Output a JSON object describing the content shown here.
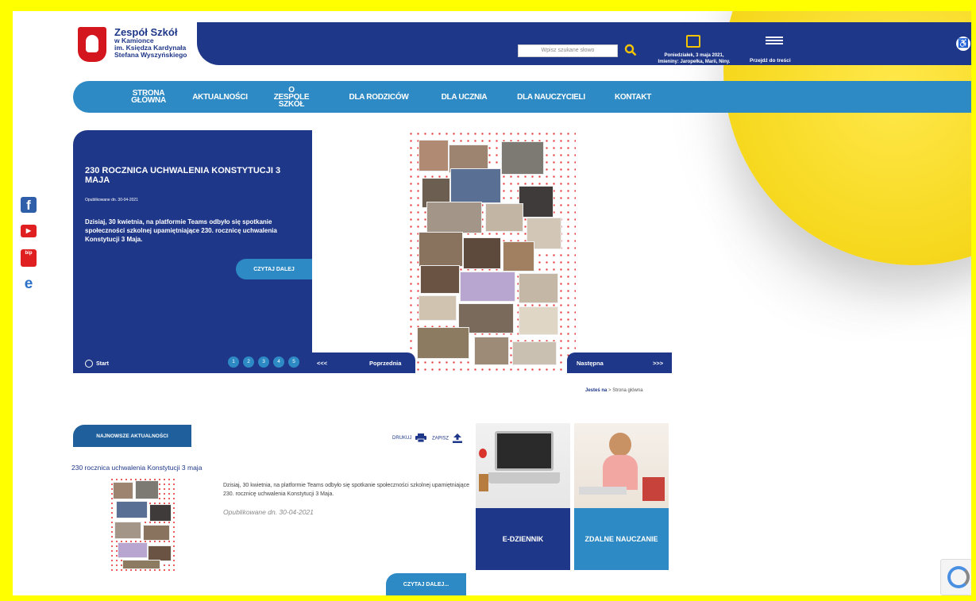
{
  "logo": {
    "line1": "Zespół Szkół",
    "line2": "w Kamionce",
    "line3": "im. Księdza Kardynała",
    "line4": "Stefana Wyszyńskiego"
  },
  "header": {
    "search_placeholder": "Wpisz szukane słowo",
    "date_line1": "Poniedziałek, 3 maja 2021,",
    "date_line2": "Imieniny: Jaropełka, Marii, Niny.",
    "skip_label": "Przejdź do treści"
  },
  "nav": {
    "items": [
      "STRONA GŁÓWNA",
      "AKTUALNOŚCI",
      "O ZESPOLE SZKÓŁ",
      "DLA RODZICÓW",
      "DLA UCZNIA",
      "DLA NAUCZYCIELI",
      "KONTAKT"
    ]
  },
  "hero": {
    "title": "230 ROCZNICA UCHWALENIA KONSTYTUCJI 3 MAJA",
    "date": "Opublikowane dn. 30-04-2021",
    "text": "Dzisiaj, 30 kwietnia, na platformie Teams odbyło się spotkanie społeczności szkolnej upamiętniające 230. rocznicę uchwalenia Konstytucji 3 Maja.",
    "read_more": "CZYTAJ DALEJ",
    "start_label": "Start",
    "pages": [
      "1",
      "2",
      "3",
      "4",
      "5"
    ],
    "prev_arrows": "<<<",
    "prev_label": "Poprzednia",
    "next_label": "Następna",
    "next_arrows": ">>>"
  },
  "breadcrumb": {
    "prefix": "Jesteś na",
    "sep": " > ",
    "current": "Strona główna"
  },
  "news": {
    "tab_label": "NAJNOWSZE AKTUALNOŚCI",
    "print_label": "DRUKUJ",
    "save_label": "ZAPISZ",
    "title": "230 rocznica uchwalenia Konstytucji 3 maja",
    "text": "Dzisiaj, 30 kwietnia, na platformie Teams odbyło się spotkanie społeczności szkolnej upamiętniające 230. rocznicę uchwalenia Konstytucji 3 Maja.",
    "date": "Opublikowane dn. 30-04-2021",
    "read_more": "CZYTAJ DALEJ..."
  },
  "tiles": {
    "ediary": "E-DZIENNIK",
    "remote": "ZDALNE NAUCZANIE"
  },
  "social": {
    "facebook": "f",
    "youtube": "▶",
    "bip": "bip",
    "edge": "e"
  },
  "colors": {
    "navy": "#1e3788",
    "blue": "#2d8ac4",
    "yellow": "#f5c400"
  }
}
